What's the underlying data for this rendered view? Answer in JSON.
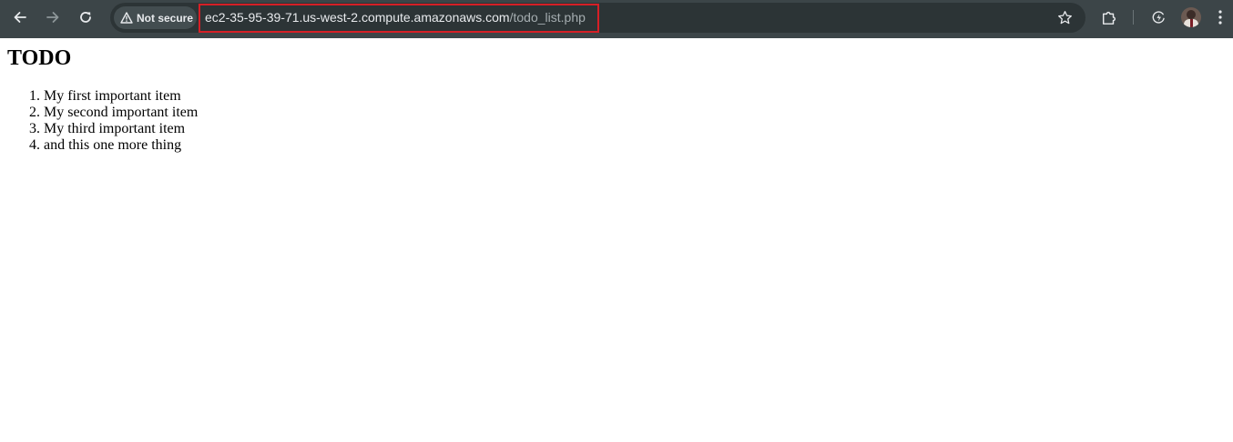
{
  "browser": {
    "security_label": "Not secure",
    "url_host": "ec2-35-95-39-71.us-west-2.compute.amazonaws.com",
    "url_path": "/todo_list.php",
    "highlight_color": "#d61f26",
    "toolbar_color": "#3c4548",
    "icons": {
      "back": "back-arrow-icon",
      "forward": "forward-arrow-icon",
      "reload": "reload-icon",
      "warning": "warning-triangle-icon",
      "bookmark": "star-icon",
      "extensions": "puzzle-piece-icon",
      "performance": "lightning-icon",
      "profile": "avatar",
      "menu": "kebab-menu-icon"
    }
  },
  "page": {
    "heading": "TODO",
    "items": [
      "My first important item",
      "My second important item",
      "My third important item",
      "and this one more thing"
    ]
  }
}
